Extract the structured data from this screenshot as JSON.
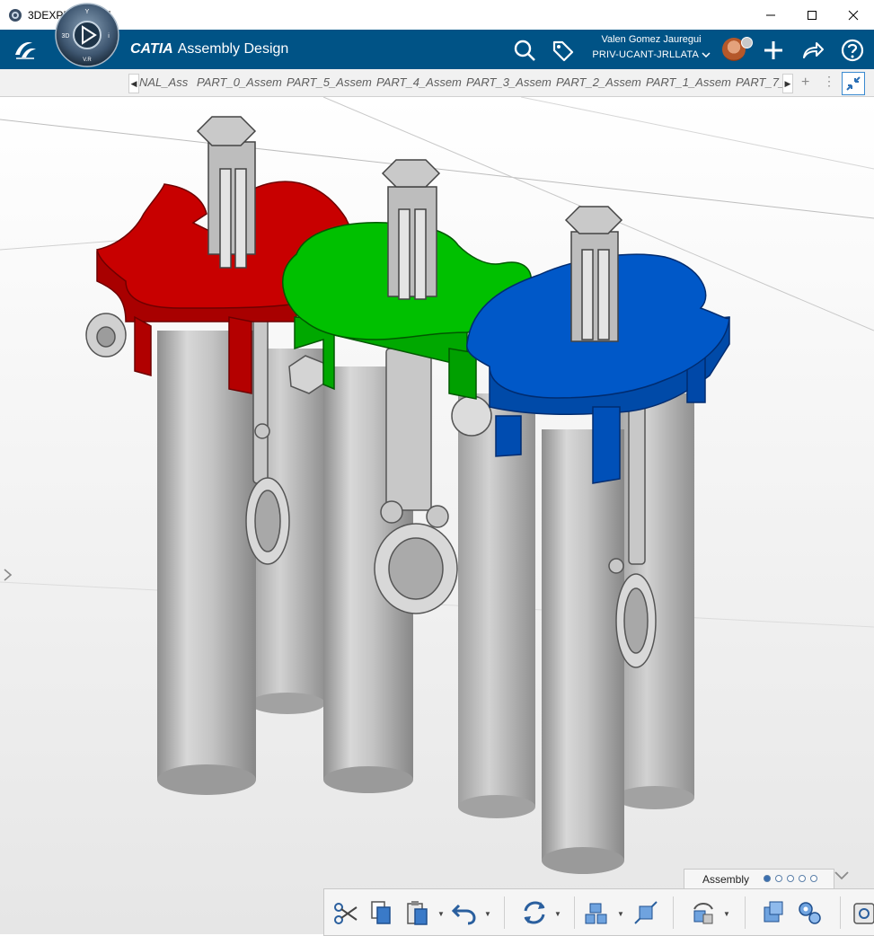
{
  "window": {
    "title": "3DEXPERIENCE",
    "icons": [
      "app-icon",
      "minimize-icon",
      "maximize-icon",
      "close-icon"
    ]
  },
  "header": {
    "brand_bold": "CATIA",
    "app_name": "Assembly Design",
    "compass_labels": {
      "top": "Y",
      "left": "3D",
      "right": "i",
      "bottom": "V.R"
    },
    "user_name": "Valen Gomez Jauregui",
    "tenant": "PRIV-UCANT-JRLLATA",
    "icons": [
      "search-icon",
      "tag-icon",
      "add-icon",
      "share-icon",
      "help-icon"
    ]
  },
  "tabs": {
    "items": [
      "NAL_Ass",
      "PART_0_Assem",
      "PART_5_Assem",
      "PART_4_Assem",
      "PART_3_Assem",
      "PART_2_Assem",
      "PART_1_Assem",
      "PART_7_"
    ],
    "plus": "+",
    "more": "⋮"
  },
  "action_bar": {
    "section_label": "Assembly",
    "page_count": 5,
    "active_page": 0,
    "tools": [
      "cut-icon",
      "copy-icon",
      "paste-icon",
      "undo-icon",
      "update-icon",
      "insert-product-icon",
      "explode-icon",
      "engineering-connection-icon",
      "assembly-icon",
      "gear-assembly-icon",
      "more-tool-icon"
    ]
  },
  "colors": {
    "header_bg": "#005386",
    "part_red": "#c80000",
    "part_green": "#00c000",
    "part_blue": "#0058c8",
    "metal_gray": "#bdbdbd"
  }
}
